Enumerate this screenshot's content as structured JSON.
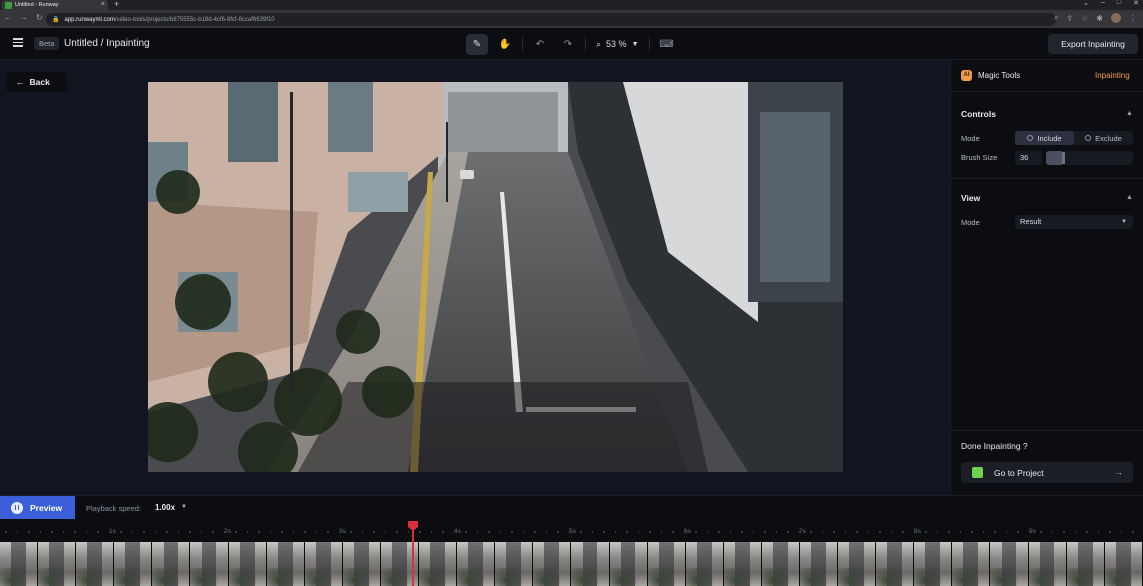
{
  "browser": {
    "tab_title": "Untitled - Runway",
    "url_domain": "app.runwayml.com",
    "url_path": "/video-tools/projects/b875555c-b18d-4cf6-8fcf-6ccaf6939f10"
  },
  "header": {
    "badge": "Beta",
    "title": "Untitled  / Inpainting",
    "zoom": "53 %",
    "export_label": "Export Inpainting"
  },
  "stage": {
    "back_label": "Back"
  },
  "panel": {
    "tool_icon_text": "AI",
    "tool_name": "Magic Tools",
    "tool_mode": "Inpainting",
    "controls_title": "Controls",
    "mode_label": "Mode",
    "mode_options": [
      "Include",
      "Exclude"
    ],
    "brush_label": "Brush Size",
    "brush_value": "36",
    "brush_fraction": 0.18,
    "view_title": "View",
    "view_mode_label": "Mode",
    "view_mode_value": "Result",
    "done_label": "Done Inpainting ?",
    "go_project_label": "Go to Project"
  },
  "timeline": {
    "preview_label": "Preview",
    "speed_label": "Playback speed:",
    "speed_value": "1.00x",
    "ticks": [
      "1s",
      "2s",
      "3s",
      "4s",
      "5s",
      "6s",
      "7s",
      "8s",
      "9s"
    ]
  },
  "colors": {
    "accent": "#3b5fd8",
    "magic_tools": "#f29c4a",
    "playhead": "#d9303e",
    "project_icon": "#6fd34b"
  }
}
